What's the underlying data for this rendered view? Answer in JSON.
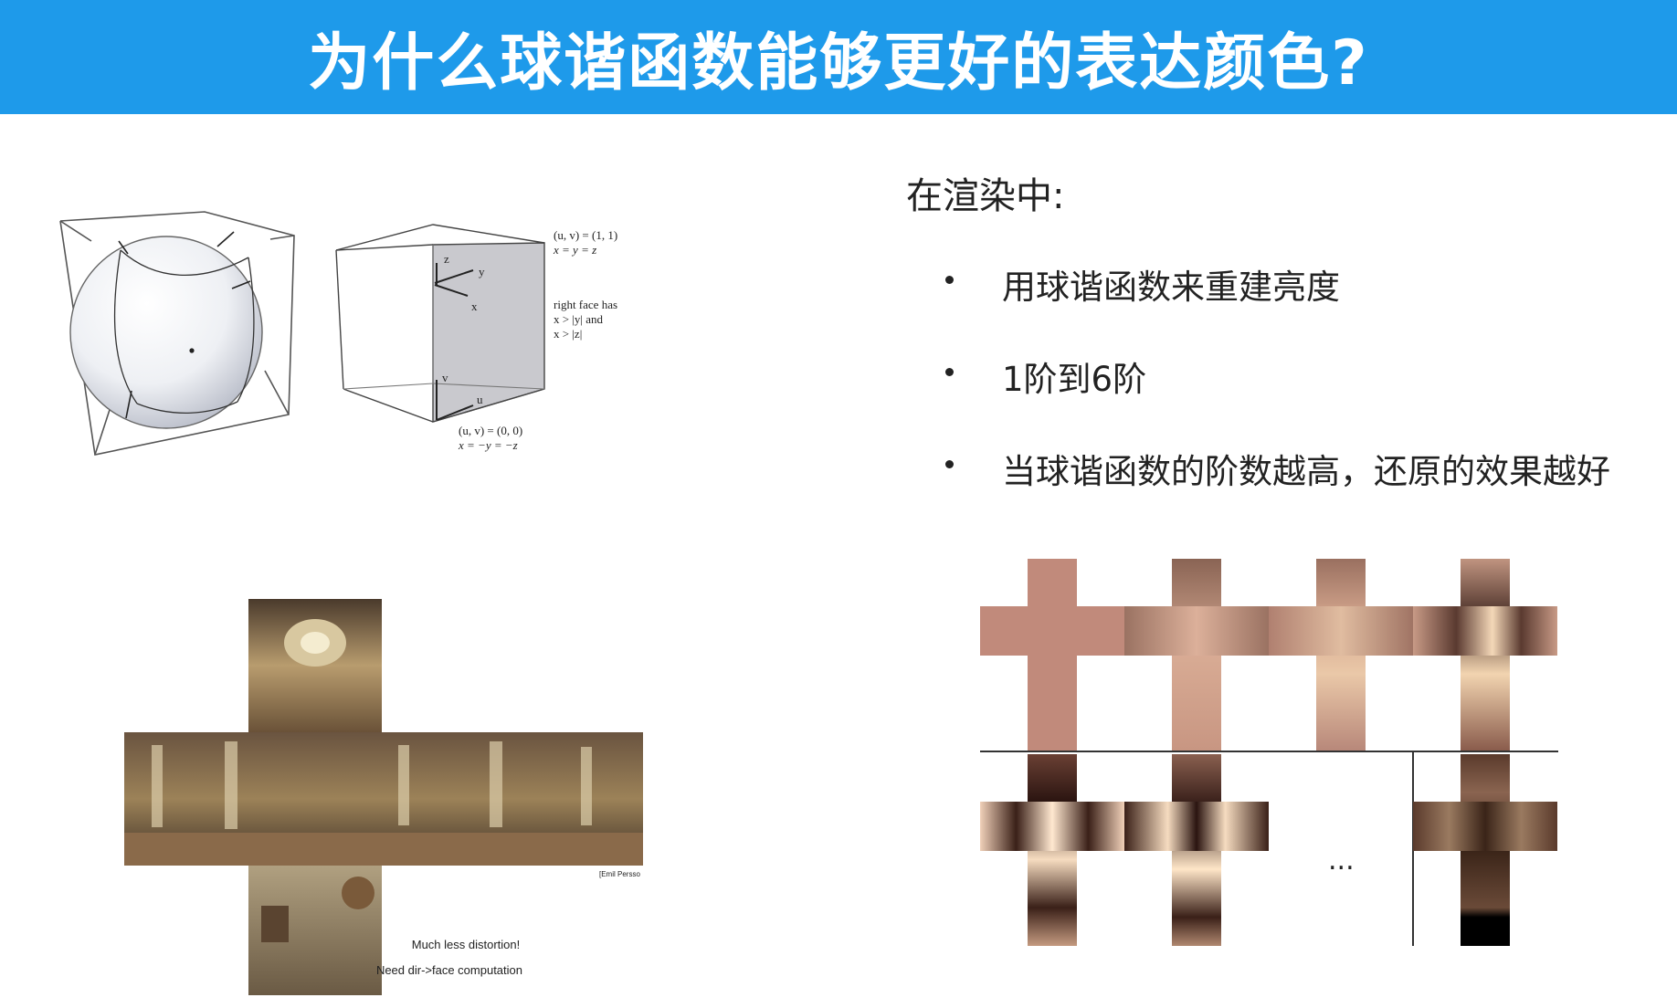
{
  "slide": {
    "title": "为什么球谐函数能够更好的表达颜色?",
    "right_heading": "在渲染中:",
    "bullets": [
      "用球谐函数来重建亮度",
      "1阶到6阶",
      "当球谐函数的阶数越高，还原的效果越好"
    ],
    "ellipsis": "..."
  },
  "cube_figure": {
    "annotation_top": [
      "(u, v) = (1, 1)",
      "x = y = z"
    ],
    "annotation_mid": [
      "right face has",
      "x > |y| and",
      "x > |z|"
    ],
    "annotation_bottom": [
      "(u, v) = (0, 0)",
      "x = −y = −z"
    ],
    "axis_z": "z",
    "axis_y": "y",
    "axis_x": "x",
    "axis_v": "v",
    "axis_u": "u"
  },
  "cubemap_figure": {
    "credit": "[Emil Persso",
    "caption_1": "Much less distortion!",
    "caption_2": "Need dir->face computation"
  },
  "colors": {
    "title_bar": "#1e9aea",
    "title_text": "#ffffff",
    "skin": "#c48c7c"
  }
}
